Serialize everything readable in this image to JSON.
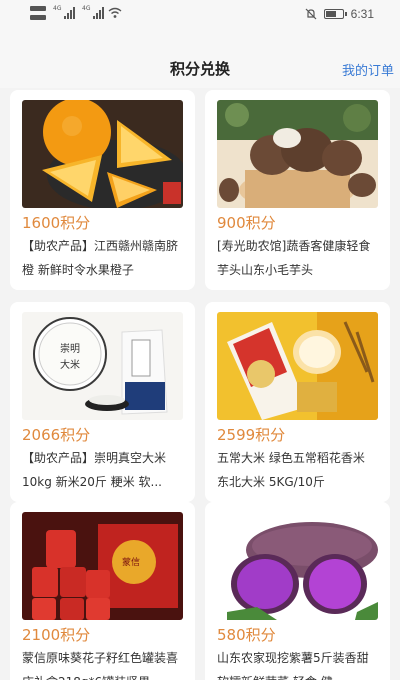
{
  "status_bar": {
    "time": "6:31",
    "sim1_tag": "4G",
    "sim2_tag": "4G",
    "icons": [
      "sim-icon",
      "signal-icon",
      "signal-icon",
      "wifi-icon",
      "mute-bell-icon",
      "battery-icon"
    ]
  },
  "header": {
    "title": "积分兑换",
    "orders_link": "我的订单"
  },
  "products": [
    {
      "points": "1600积分",
      "title": "【助农产品】江西赣州赣南脐橙 新鲜时令水果橙子",
      "image": "oranges"
    },
    {
      "points": "900积分",
      "title": "[寿光助农馆]蔬香客健康轻食 芋头山东小毛芋头",
      "image": "taro"
    },
    {
      "points": "2066积分",
      "title": "【助农产品】崇明真空大米10kg 新米20斤 粳米 软...",
      "image": "rice"
    },
    {
      "points": "2599积分",
      "title": "五常大米 绿色五常稻花香米 东北大米 5KG/10斤",
      "image": "wuchang-rice"
    },
    {
      "points": "2100积分",
      "title": "蒙信原味葵花子籽红色罐装喜庆礼盒218g*6罐装坚果",
      "image": "sunflower-seeds"
    },
    {
      "points": "580积分",
      "title": "山东农家现挖紫薯5斤装香甜软糯新鲜蔬菜 轻食 健",
      "image": "purple-sweet-potato"
    }
  ],
  "colors": {
    "points": "#e0893d",
    "link": "#3a7bd5",
    "background": "#f3f3f3"
  }
}
